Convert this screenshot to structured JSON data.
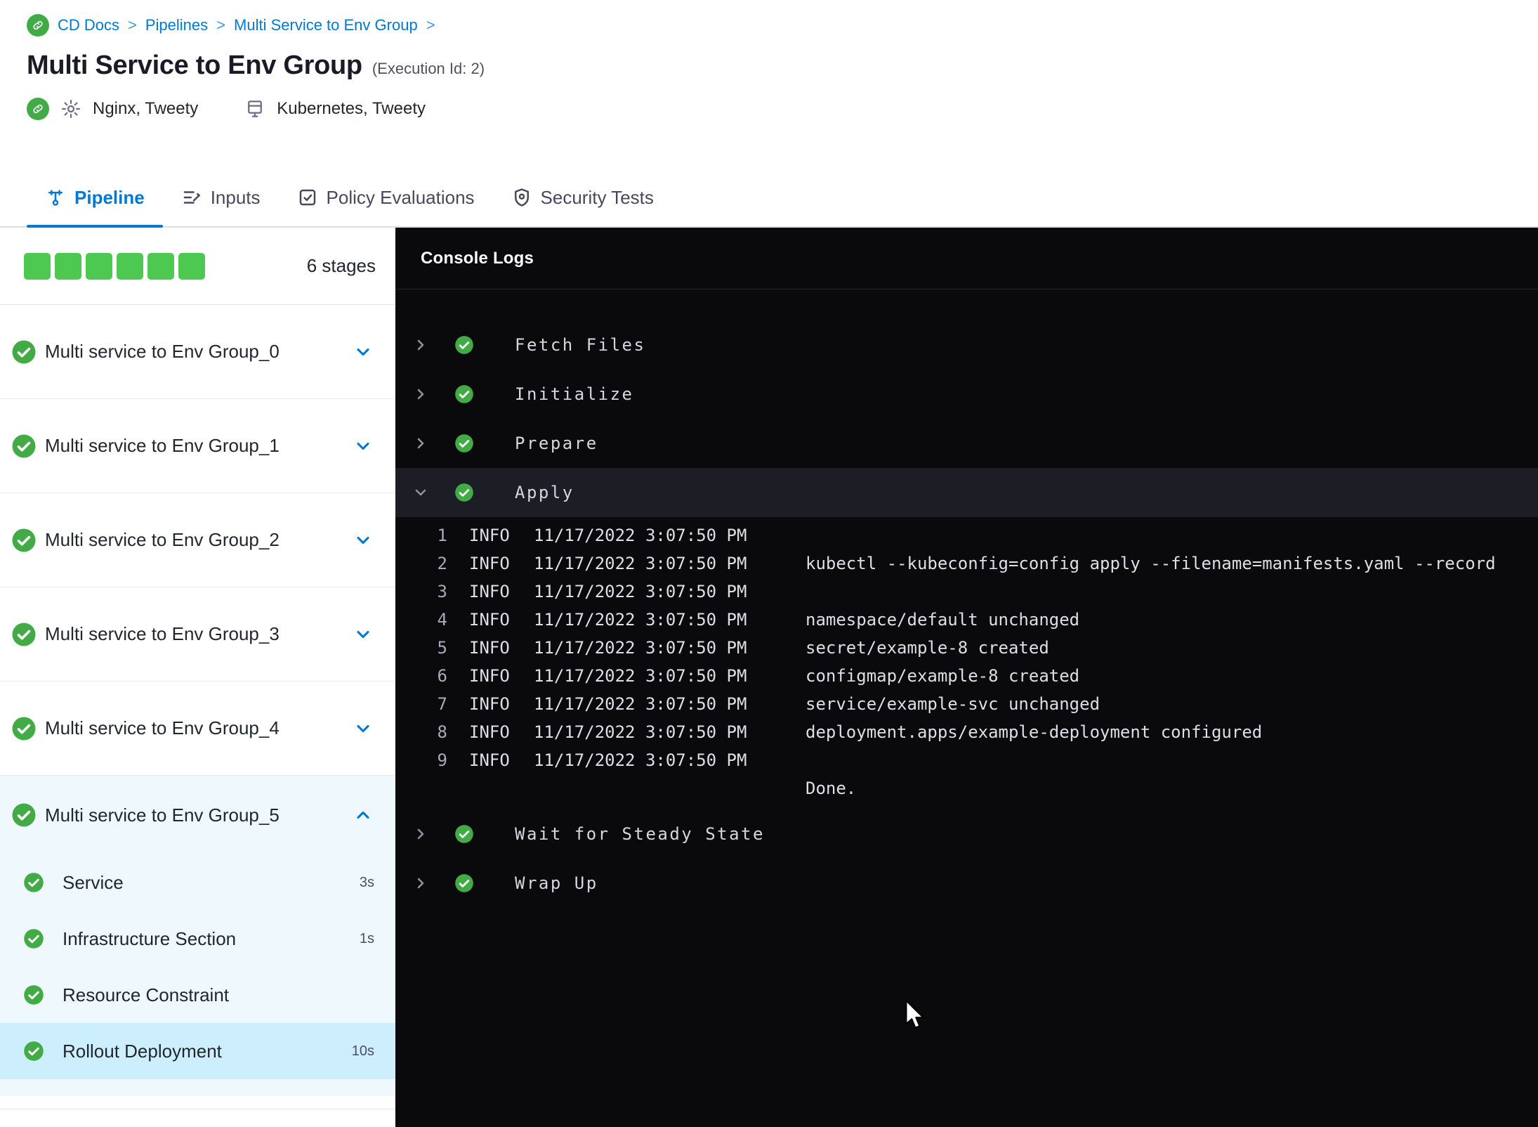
{
  "breadcrumb": {
    "separator": ">",
    "items": [
      {
        "label": "CD Docs"
      },
      {
        "label": "Pipelines"
      },
      {
        "label": "Multi Service to Env Group"
      }
    ]
  },
  "header": {
    "title": "Multi Service to Env Group",
    "execution_id": "(Execution Id: 2)",
    "services_label": "Nginx, Tweety",
    "environments_label": "Kubernetes, Tweety"
  },
  "tabs": [
    {
      "label": "Pipeline"
    },
    {
      "label": "Inputs"
    },
    {
      "label": "Policy Evaluations"
    },
    {
      "label": "Security Tests"
    }
  ],
  "sidebar": {
    "stages_count": "6 stages",
    "stages": [
      {
        "label": "Multi service to Env Group_0"
      },
      {
        "label": "Multi service to Env Group_1"
      },
      {
        "label": "Multi service to Env Group_2"
      },
      {
        "label": "Multi service to Env Group_3"
      },
      {
        "label": "Multi service to Env Group_4"
      },
      {
        "label": "Multi service to Env Group_5"
      }
    ],
    "steps": [
      {
        "label": "Service",
        "duration": "3s"
      },
      {
        "label": "Infrastructure Section",
        "duration": "1s"
      },
      {
        "label": "Resource Constraint",
        "duration": ""
      },
      {
        "label": "Rollout Deployment",
        "duration": "10s"
      }
    ]
  },
  "console": {
    "title": "Console Logs",
    "steps": [
      {
        "label": "Fetch Files"
      },
      {
        "label": "Initialize"
      },
      {
        "label": "Prepare"
      },
      {
        "label": "Apply"
      },
      {
        "label": "Wait for Steady State"
      },
      {
        "label": "Wrap Up"
      }
    ],
    "logs": [
      {
        "num": "1",
        "level": "INFO",
        "time": "11/17/2022 3:07:50 PM",
        "msg": ""
      },
      {
        "num": "2",
        "level": "INFO",
        "time": "11/17/2022 3:07:50 PM",
        "msg": "kubectl --kubeconfig=config apply --filename=manifests.yaml --record"
      },
      {
        "num": "3",
        "level": "INFO",
        "time": "11/17/2022 3:07:50 PM",
        "msg": ""
      },
      {
        "num": "4",
        "level": "INFO",
        "time": "11/17/2022 3:07:50 PM",
        "msg": "namespace/default unchanged"
      },
      {
        "num": "5",
        "level": "INFO",
        "time": "11/17/2022 3:07:50 PM",
        "msg": "secret/example-8 created"
      },
      {
        "num": "6",
        "level": "INFO",
        "time": "11/17/2022 3:07:50 PM",
        "msg": "configmap/example-8 created"
      },
      {
        "num": "7",
        "level": "INFO",
        "time": "11/17/2022 3:07:50 PM",
        "msg": "service/example-svc unchanged"
      },
      {
        "num": "8",
        "level": "INFO",
        "time": "11/17/2022 3:07:50 PM",
        "msg": "deployment.apps/example-deployment configured"
      },
      {
        "num": "9",
        "level": "INFO",
        "time": "11/17/2022 3:07:50 PM",
        "msg": ""
      },
      {
        "num": "",
        "level": "",
        "time": "",
        "msg": "Done."
      }
    ]
  },
  "colors": {
    "accent_blue": "#0278d5",
    "success_green": "#42ab45",
    "console_bg": "#0a0a0c"
  }
}
